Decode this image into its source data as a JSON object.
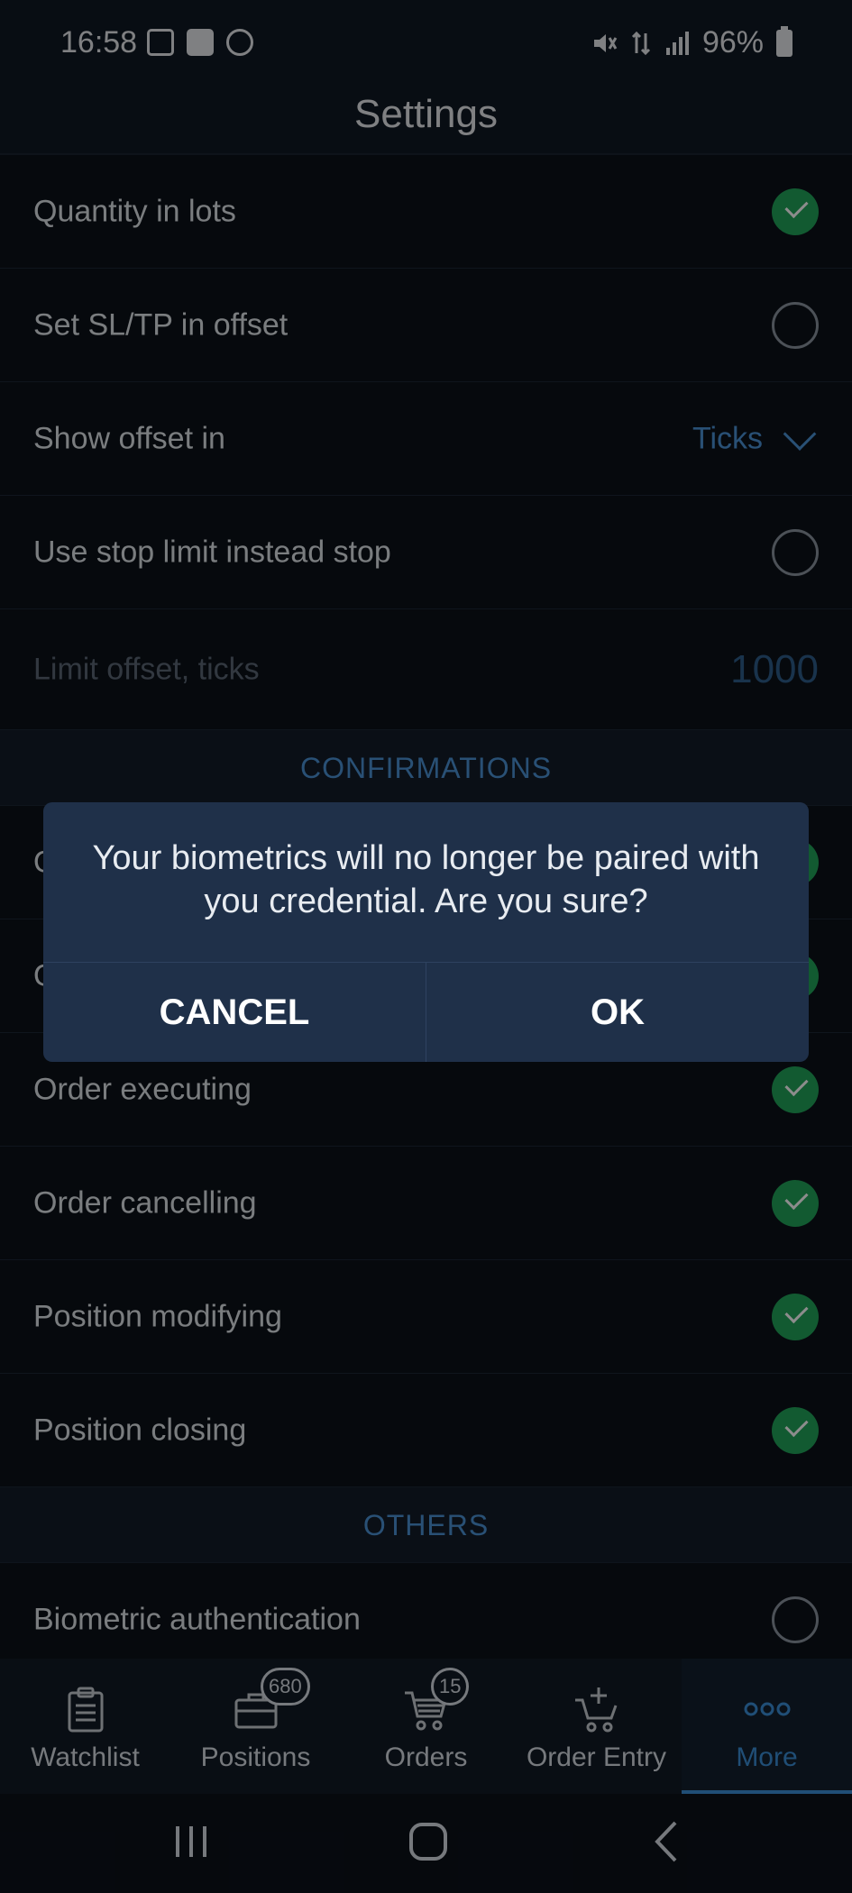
{
  "status_bar": {
    "time": "16:58",
    "battery": "96%",
    "left_icons": [
      "gallery-icon",
      "check-icon",
      "apps-icon"
    ],
    "right_icons": [
      "mute-icon",
      "data-icon",
      "signal-icon",
      "battery-icon"
    ]
  },
  "header": {
    "title": "Settings"
  },
  "settings": {
    "quantity_in_lots": {
      "label": "Quantity in lots",
      "checked": true
    },
    "set_sltp_offset": {
      "label": "Set SL/TP in offset",
      "checked": false
    },
    "show_offset_in": {
      "label": "Show offset in",
      "value": "Ticks"
    },
    "use_stop_limit": {
      "label": "Use stop limit instead stop",
      "checked": false
    },
    "limit_offset": {
      "label": "Limit offset, ticks",
      "value": "1000"
    },
    "confirmations_header": "CONFIRMATIONS",
    "confirm_row_1": {
      "label": "O",
      "checked": true
    },
    "confirm_row_2": {
      "label": "O",
      "checked": true
    },
    "order_executing": {
      "label": "Order executing",
      "checked": true
    },
    "order_cancelling": {
      "label": "Order cancelling",
      "checked": true
    },
    "position_modifying": {
      "label": "Position modifying",
      "checked": true
    },
    "position_closing": {
      "label": "Position closing",
      "checked": true
    },
    "others_header": "OTHERS",
    "biometric_auth": {
      "label": "Biometric authentication",
      "checked": false
    }
  },
  "bottom_nav": {
    "watchlist": {
      "label": "Watchlist",
      "icon": "clipboard-icon"
    },
    "positions": {
      "label": "Positions",
      "icon": "briefcase-icon",
      "badge": "680"
    },
    "orders": {
      "label": "Orders",
      "icon": "cart-icon",
      "badge": "15"
    },
    "order_entry": {
      "label": "Order Entry",
      "icon": "cart-add-icon"
    },
    "more": {
      "label": "More",
      "icon": "more-icon",
      "active": true
    }
  },
  "dialog": {
    "message": "Your biometrics will no longer be paired with you credential. Are you sure?",
    "cancel_label": "CANCEL",
    "ok_label": "OK"
  },
  "colors": {
    "background": "#0b1119",
    "accent": "#3b8fd8",
    "check_on": "#22a45a",
    "dialog": "#1f3049"
  }
}
